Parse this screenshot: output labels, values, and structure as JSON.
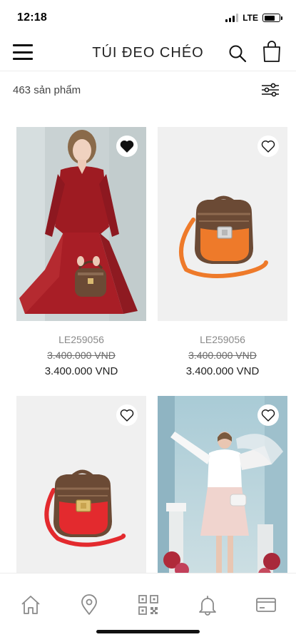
{
  "status_bar": {
    "time": "12:18",
    "network": "LTE",
    "battery_level": 0.7
  },
  "header": {
    "title": "TÚI ĐEO CHÉO"
  },
  "list": {
    "count_text": "463 sản phẩm"
  },
  "products": [
    {
      "sku": "LE259056",
      "old_price": "3.400.000 VND",
      "price": "3.400.000 VND",
      "favorited": true,
      "image": "model in red dress with brown logo handbag"
    },
    {
      "sku": "LE259056",
      "old_price": "3.400.000 VND",
      "price": "3.400.000 VND",
      "favorited": false,
      "image": "brown monogram saddle bag with orange flap"
    },
    {
      "favorited": false,
      "image": "brown monogram saddle bag with red flap"
    },
    {
      "favorited": false,
      "image": "model in white blouse and pink skirt"
    }
  ],
  "bottom_nav": [
    {
      "icon": "home-icon"
    },
    {
      "icon": "location-pin-icon"
    },
    {
      "icon": "qr-code-icon"
    },
    {
      "icon": "bell-icon"
    },
    {
      "icon": "card-icon"
    }
  ],
  "colors": {
    "accent": "#111111",
    "red_dress": "#9e1b22",
    "orange_flap": "#ee7a2a",
    "red_flap": "#e32a2e",
    "bag_brown": "#6b4a35"
  }
}
